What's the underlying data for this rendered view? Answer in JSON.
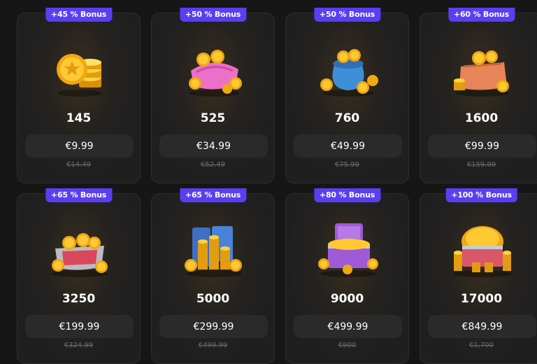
{
  "colors": {
    "background": "#161616",
    "card": "#1f1f20",
    "badge": "#5a3ff2",
    "price_button": "#2a2a2b",
    "old_price": "#6b6b6b",
    "coin_gold": "#f5b81a"
  },
  "packs": [
    {
      "bonus": "+45 % Bonus",
      "coins": "145",
      "price": "€9.99",
      "old_price": "€14.49",
      "icon": "coin-stack-icon"
    },
    {
      "bonus": "+50 % Bonus",
      "coins": "525",
      "price": "€34.99",
      "old_price": "€52.49",
      "icon": "pink-coin-purse-icon"
    },
    {
      "bonus": "+50 % Bonus",
      "coins": "760",
      "price": "€49.99",
      "old_price": "€75.99",
      "icon": "blue-coin-bag-icon"
    },
    {
      "bonus": "+60 % Bonus",
      "coins": "1600",
      "price": "€99.99",
      "old_price": "€159.99",
      "icon": "orange-coin-bag-icon"
    },
    {
      "bonus": "+65 % Bonus",
      "coins": "3250",
      "price": "€199.99",
      "old_price": "€324.99",
      "icon": "coin-basket-icon"
    },
    {
      "bonus": "+65 % Bonus",
      "coins": "5000",
      "price": "€299.99",
      "old_price": "€499.99",
      "icon": "coin-vault-icon"
    },
    {
      "bonus": "+80 % Bonus",
      "coins": "9000",
      "price": "€499.99",
      "old_price": "€900",
      "icon": "treasure-chest-icon"
    },
    {
      "bonus": "+100 % Bonus",
      "coins": "17000",
      "price": "€849.99",
      "old_price": "€1,700",
      "icon": "coin-crate-icon"
    }
  ]
}
